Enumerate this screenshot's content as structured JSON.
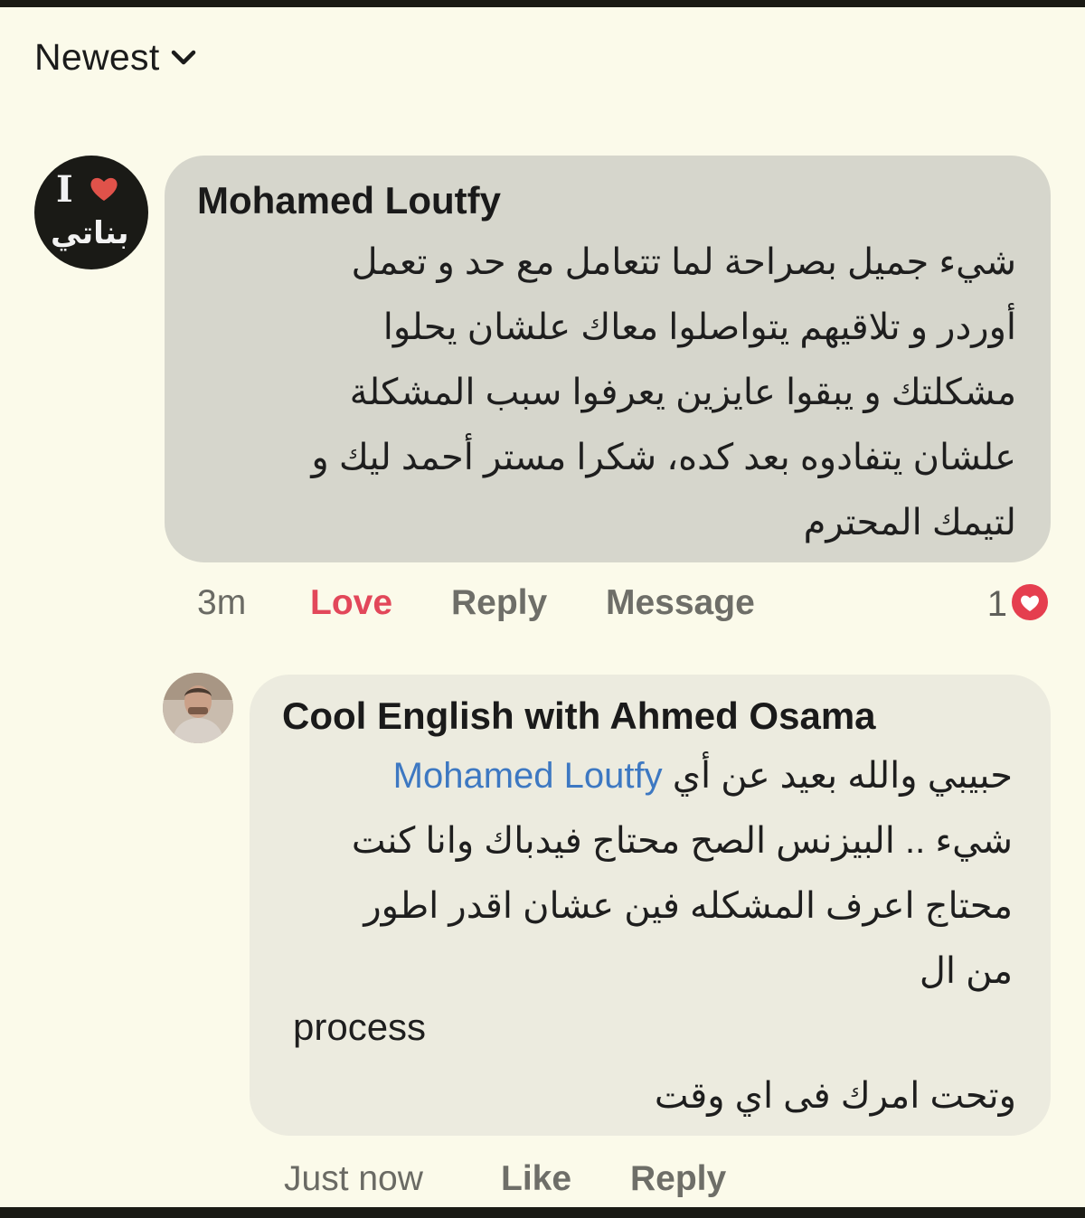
{
  "sort": {
    "label": "Newest"
  },
  "comments": [
    {
      "author": "Mohamed Loutfy",
      "avatar_text": {
        "letter": "I",
        "arabic": "بناتي"
      },
      "lines": [
        "شيء جميل بصراحة لما تتعامل مع حد و تعمل",
        "أوردر و تلاقيهم يتواصلوا معاك علشان يحلوا",
        "مشكلتك و يبقوا عايزين يعرفوا سبب المشكلة",
        "علشان يتفادوه بعد كده، شكرا مستر أحمد ليك و",
        "لتيمك المحترم"
      ],
      "actions": {
        "time": "3m",
        "love": "Love",
        "reply": "Reply",
        "message": "Message"
      },
      "reaction_count": "1"
    },
    {
      "author": "Cool English with Ahmed Osama",
      "mention": "Mohamed Loutfy",
      "line1_text": "حبيبي والله بعيد عن أي",
      "lines": [
        "شيء .. البيزنس الصح محتاج فيدباك وانا كنت",
        "محتاج اعرف المشكله فين عشان اقدر اطور",
        "من ال"
      ],
      "latin_line": "process",
      "last_line": "وتحت امرك فى اي وقت",
      "actions": {
        "time": "Just now",
        "like": "Like",
        "reply": "Reply"
      }
    }
  ],
  "colors": {
    "background": "#fbfaea",
    "bubble_main": "#d6d6cc",
    "bubble_reply": "#ecebdf",
    "love": "#e2475a",
    "mention": "#3d78c2",
    "heart_reaction": "#e53e4f"
  }
}
